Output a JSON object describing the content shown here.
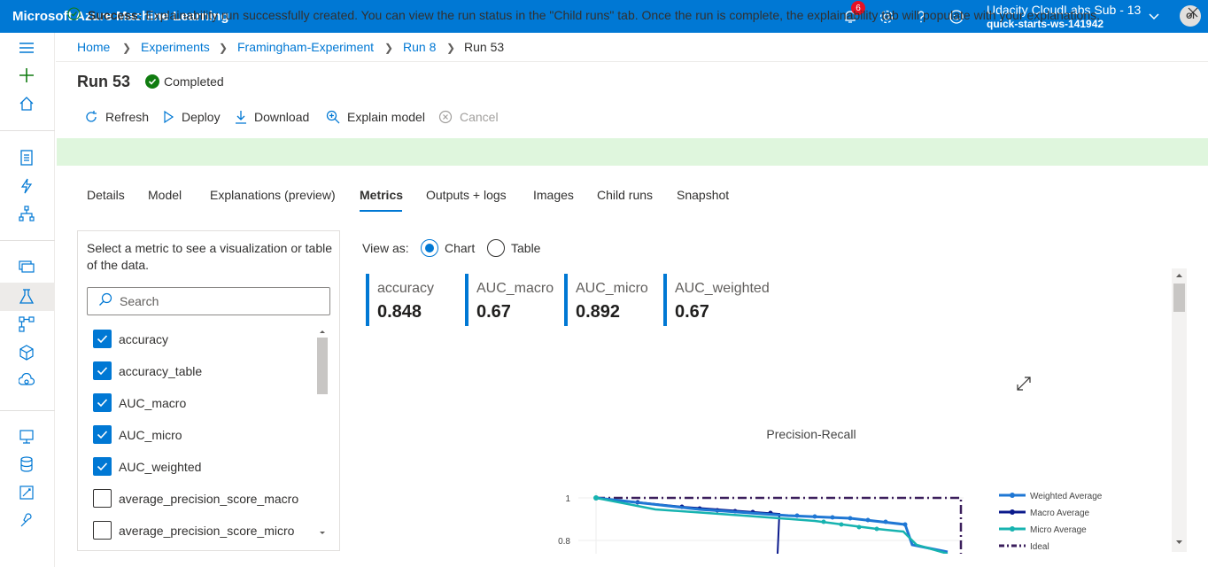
{
  "app": {
    "title": "Microsoft Azure Machine Learning"
  },
  "topbar": {
    "notifications_count": "6",
    "account_name": "Udacity CloudLabs Sub - 13",
    "workspace": "quick-starts-ws-141942",
    "avatar_initials": "OI"
  },
  "breadcrumb": [
    "Home",
    "Experiments",
    "Framingham-Experiment",
    "Run 8",
    "Run 53"
  ],
  "run": {
    "title": "Run 53",
    "status": "Completed"
  },
  "commands": {
    "refresh": "Refresh",
    "deploy": "Deploy",
    "download": "Download",
    "explain": "Explain model",
    "cancel": "Cancel"
  },
  "banner": {
    "strong": "Success:",
    "text": " Explainability run successfully created. You can view the run status in the \"Child runs\" tab. Once the run is complete, the explainability tab will populate with your explanations."
  },
  "tabs": [
    "Details",
    "Model",
    "Explanations (preview)",
    "Metrics",
    "Outputs + logs",
    "Images",
    "Child runs",
    "Snapshot"
  ],
  "metrics_panel": {
    "description": "Select a metric to see a visualization or table of the data.",
    "search_placeholder": "Search",
    "items": [
      {
        "label": "accuracy",
        "checked": true
      },
      {
        "label": "accuracy_table",
        "checked": true
      },
      {
        "label": "AUC_macro",
        "checked": true
      },
      {
        "label": "AUC_micro",
        "checked": true
      },
      {
        "label": "AUC_weighted",
        "checked": true
      },
      {
        "label": "average_precision_score_macro",
        "checked": false
      },
      {
        "label": "average_precision_score_micro",
        "checked": false
      }
    ]
  },
  "view_as": {
    "label": "View as:",
    "chart": "Chart",
    "table": "Table",
    "selected": "Chart"
  },
  "tiles": [
    {
      "name": "accuracy",
      "value": "0.848"
    },
    {
      "name": "AUC_macro",
      "value": "0.67"
    },
    {
      "name": "AUC_micro",
      "value": "0.892"
    },
    {
      "name": "AUC_weighted",
      "value": "0.67"
    }
  ],
  "chart_data": {
    "type": "line",
    "title": "Precision-Recall",
    "y_ticks": [
      "1",
      "0.8"
    ],
    "legend": [
      "Weighted Average",
      "Macro Average",
      "Micro Average",
      "Ideal"
    ],
    "colors": {
      "Weighted Average": "#1f77d4",
      "Macro Average": "#0b1a8c",
      "Micro Average": "#17b3b0",
      "Ideal": "#3b1f5c"
    }
  },
  "colors": {
    "accent": "#0078d4",
    "success": "#107c10",
    "banner": "#dff6dd"
  }
}
